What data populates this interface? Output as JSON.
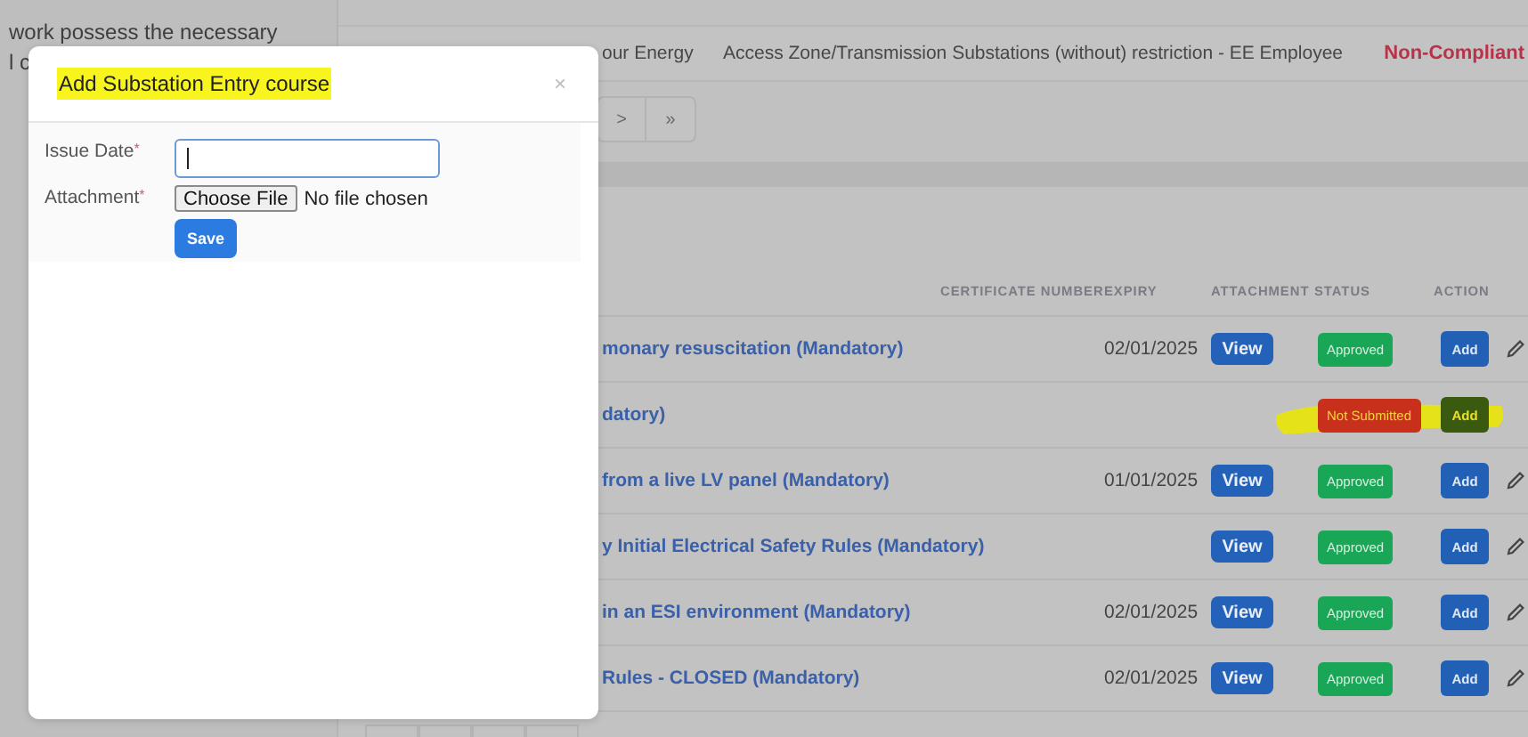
{
  "background_text": {
    "lines": [
      "work possess the necessary",
      "l c"
    ]
  },
  "requirement": {
    "course": "our Energy",
    "zone": "Access Zone/Transmission Substations (without) restriction - EE Employee",
    "status": "Non-Compliant"
  },
  "pagination": [
    ">",
    "»"
  ],
  "table": {
    "columns": [
      "CERTIFICATE NUMBER",
      "EXPIRY",
      "ATTACHMENT",
      "STATUS",
      "ACTION"
    ],
    "rows": [
      {
        "course": "monary resuscitation (Mandatory)",
        "expiry": "02/01/2025",
        "attachment": "View",
        "status": "Approved",
        "color": "#19a657",
        "action": "Add",
        "editable": true,
        "highlighted": false
      },
      {
        "course": "datory)",
        "status": "Not Submitted",
        "color": "#c9301c",
        "action": "Add",
        "editable": false,
        "highlighted": true
      },
      {
        "course": "from a live LV panel (Mandatory)",
        "expiry": "01/01/2025",
        "attachment": "View",
        "status": "Approved",
        "color": "#19a657",
        "action": "Add",
        "editable": true,
        "highlighted": false
      },
      {
        "course": "y Initial Electrical Safety Rules (Mandatory)",
        "attachment": "View",
        "status": "Approved",
        "color": "#19a657",
        "action": "Add",
        "editable": true,
        "highlighted": false
      },
      {
        "course": "in an ESI environment (Mandatory)",
        "expiry": "02/01/2025",
        "attachment": "View",
        "status": "Approved",
        "color": "#19a657",
        "action": "Add",
        "editable": true,
        "highlighted": false
      },
      {
        "course": "Rules - CLOSED (Mandatory)",
        "expiry": "02/01/2025",
        "attachment": "View",
        "status": "Approved",
        "color": "#19a657",
        "action": "Add",
        "editable": true,
        "highlighted": false
      }
    ]
  },
  "modal": {
    "title": "Add Substation Entry course",
    "title_highlighted": true,
    "close": "×",
    "fields": [
      {
        "kind": "text",
        "label": "Issue Date",
        "marker": "*",
        "focused": true
      },
      {
        "kind": "file",
        "label": "Attachment",
        "marker": "*",
        "button": "Choose File",
        "value": "No file chosen"
      }
    ],
    "submit": "Save"
  }
}
